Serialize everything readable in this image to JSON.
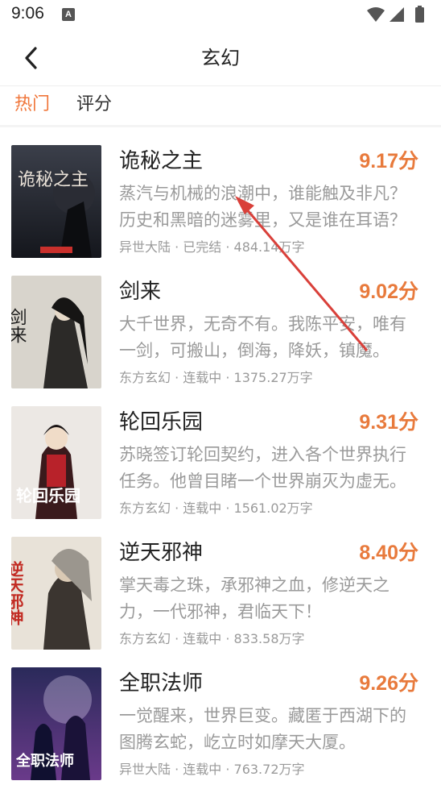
{
  "status_bar": {
    "time": "9:06",
    "notification_glyph": "A",
    "icons": [
      "wifi-icon",
      "signal-icon",
      "battery-icon"
    ]
  },
  "header": {
    "title": "玄幻"
  },
  "tabs": [
    {
      "label": "热门",
      "active": true
    },
    {
      "label": "评分",
      "active": false
    }
  ],
  "colors": {
    "accent": "#e87a3c",
    "tab_active": "#f0763a",
    "text_secondary": "#9a9a9a",
    "annotation_arrow": "#d9403a"
  },
  "books": [
    {
      "title": "诡秘之主",
      "score": "9.17分",
      "desc": "蒸汽与机械的浪潮中，谁能触及非凡？历史和黑暗的迷雾里，又是谁在耳语？",
      "meta": "异世大陆 · 已完结 · 484.14万字",
      "cover_title": "诡秘之主"
    },
    {
      "title": "剑来",
      "score": "9.02分",
      "desc": "大千世界，无奇不有。我陈平安，唯有一剑，可搬山，倒海，降妖，镇魔。",
      "meta": "东方玄幻 · 连载中 · 1375.27万字",
      "cover_title": "剑来"
    },
    {
      "title": "轮回乐园",
      "score": "9.31分",
      "desc": "苏晓签订轮回契约，进入各个世界执行任务。他曾目睹一个世界崩灭为虚无。",
      "meta": "东方玄幻 · 连载中 · 1561.02万字",
      "cover_title": "轮回乐园"
    },
    {
      "title": "逆天邪神",
      "score": "8.40分",
      "desc": "掌天毒之珠，承邪神之血，修逆天之力，一代邪神，君临天下！",
      "meta": "东方玄幻 · 连载中 · 833.58万字",
      "cover_title": "逆天邪神"
    },
    {
      "title": "全职法师",
      "score": "9.26分",
      "desc": "一觉醒来，世界巨变。藏匿于西湖下的图腾玄蛇，屹立时如摩天大厦。",
      "meta": "异世大陆 · 连载中 · 763.72万字",
      "cover_title": "全职法师"
    }
  ]
}
